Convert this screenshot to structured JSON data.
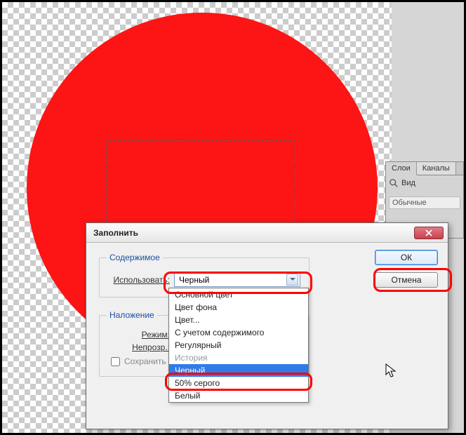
{
  "panel": {
    "tabs": {
      "layers": "Слои",
      "channels": "Каналы"
    },
    "search_label": "Вид",
    "mode_label": "Обычные"
  },
  "dialog": {
    "title": "Заполнить",
    "ok": "ОК",
    "cancel": "Отмена",
    "content": {
      "legend": "Содержимое",
      "use_label": "Использовать:",
      "use_value": "Черный"
    },
    "blend": {
      "legend": "Наложение",
      "mode_label": "Режим:",
      "opacity_label": "Непрозр.:",
      "preserve_label": "Сохранить п"
    },
    "options": [
      {
        "label": "Основной цвет",
        "state": "normal"
      },
      {
        "label": "Цвет фона",
        "state": "normal"
      },
      {
        "label": "Цвет...",
        "state": "normal"
      },
      {
        "label": "С учетом содержимого",
        "state": "normal"
      },
      {
        "label": "Регулярный",
        "state": "normal"
      },
      {
        "label": "История",
        "state": "disabled"
      },
      {
        "label": "Черный",
        "state": "selected"
      },
      {
        "label": "50% серого",
        "state": "normal"
      },
      {
        "label": "Белый",
        "state": "normal"
      }
    ]
  }
}
